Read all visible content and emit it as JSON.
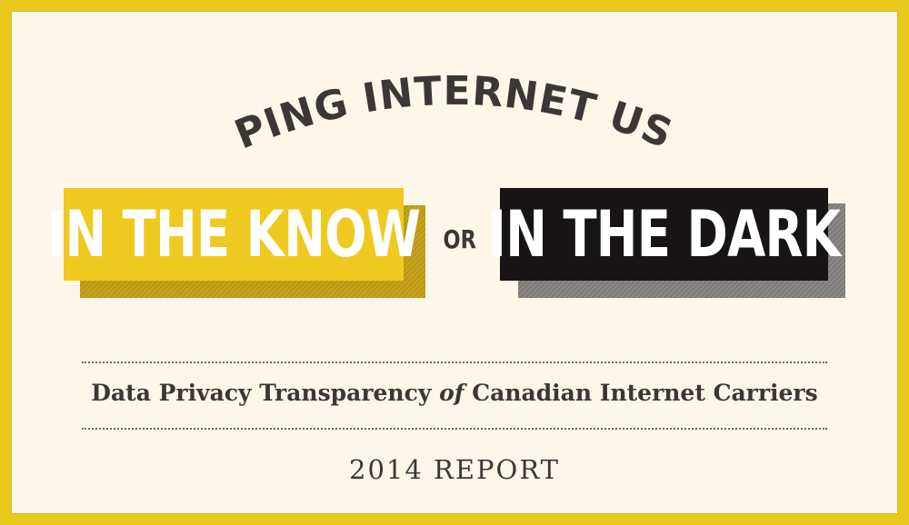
{
  "heading": {
    "arched_text": "KEEPING INTERNET USERS"
  },
  "boxes": {
    "left_text": "IN THE KNOW",
    "connector": "OR",
    "right_text": "IN THE DARK"
  },
  "subtitle": {
    "part1": "Data Privacy Transparency",
    "part2": "of",
    "part3": "Canadian Internet Carriers"
  },
  "report_label": "2014 REPORT",
  "colors": {
    "border": "#e9c81c",
    "background": "#fdf6e9",
    "yellow_box": "#efc91f",
    "dark_box": "#181416",
    "text": "#3a3736"
  }
}
